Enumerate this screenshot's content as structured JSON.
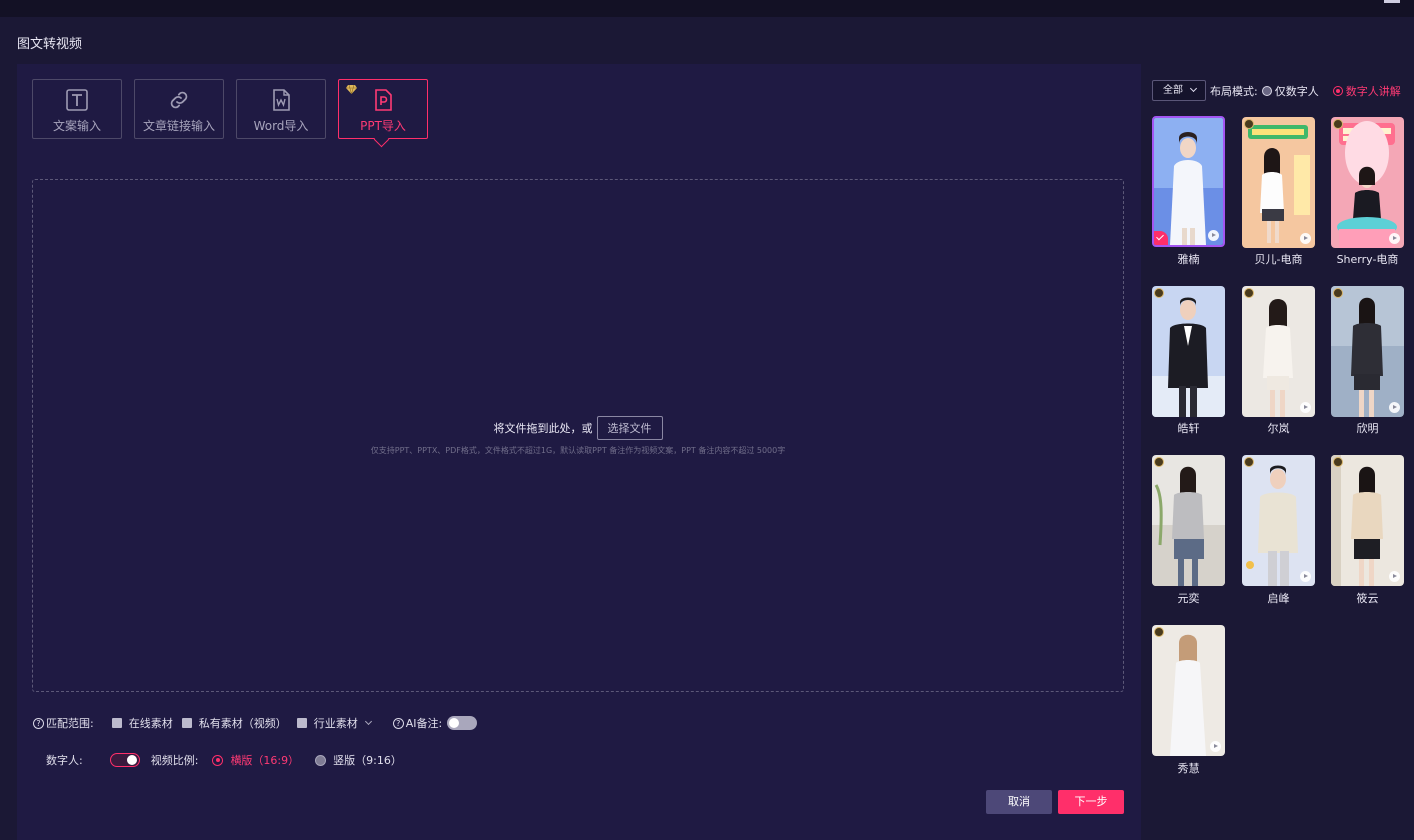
{
  "page_title": "图文转视频",
  "tabs": [
    {
      "label": "文案输入",
      "icon": "text-icon"
    },
    {
      "label": "文章链接输入",
      "icon": "link-icon"
    },
    {
      "label": "Word导入",
      "icon": "word-icon"
    },
    {
      "label": "PPT导入",
      "icon": "ppt-icon",
      "active": true,
      "vip": true
    }
  ],
  "upload": {
    "prompt": "将文件拖到此处，或",
    "select_button": "选择文件",
    "hint": "仅支持PPT、PPTX、PDF格式，文件格式不超过1G，默认读取PPT 备注作为视频文案，PPT 备注内容不超过 5000字"
  },
  "match_range": {
    "label": "匹配范围:",
    "options": [
      "在线素材",
      "私有素材（视频）",
      "行业素材"
    ],
    "ai_note_label": "AI备注:",
    "ai_note_on": false
  },
  "digital_human": {
    "label": "数字人:",
    "on": true,
    "ratio_label": "视频比例:",
    "ratios": [
      {
        "label": "横版（16:9）",
        "selected": true
      },
      {
        "label": "竖版（9:16）",
        "selected": false
      }
    ]
  },
  "buttons": {
    "cancel": "取消",
    "next": "下一步"
  },
  "sidebar": {
    "filter_label": "全部",
    "layout_label": "布局模式:",
    "layout_options": [
      {
        "label": "仅数字人",
        "selected": false
      },
      {
        "label": "数字人讲解",
        "selected": true
      }
    ],
    "avatars": [
      {
        "name": "雅楠",
        "selected": true,
        "vip": false
      },
      {
        "name": "贝儿-电商",
        "selected": false,
        "vip": true
      },
      {
        "name": "Sherry-电商",
        "selected": false,
        "vip": true
      },
      {
        "name": "皓轩",
        "selected": false,
        "vip": true
      },
      {
        "name": "尔岚",
        "selected": false,
        "vip": true
      },
      {
        "name": "欣明",
        "selected": false,
        "vip": true
      },
      {
        "name": "元奕",
        "selected": false,
        "vip": true
      },
      {
        "name": "启峰",
        "selected": false,
        "vip": true
      },
      {
        "name": "筱云",
        "selected": false,
        "vip": true
      },
      {
        "name": "秀慧",
        "selected": false,
        "vip": true
      }
    ]
  },
  "colors": {
    "accent": "#ff2f6a",
    "panel": "#1f1a43",
    "background": "#1b1835",
    "cancel_button": "#4d4878"
  }
}
